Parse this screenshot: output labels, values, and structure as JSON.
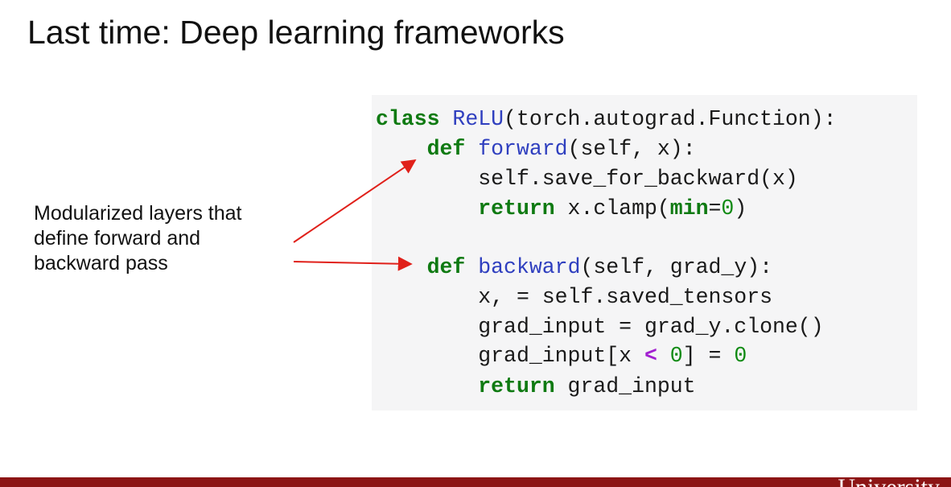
{
  "slide": {
    "title": "Last time: Deep learning frameworks",
    "caption_lines": [
      "Modularized layers that",
      "define forward and",
      "backward pass"
    ]
  },
  "code": {
    "line1": {
      "kw": "class",
      "sp": " ",
      "name": "ReLU",
      "rest": "(torch.autograd.Function):"
    },
    "line2": {
      "indent": "    ",
      "kw": "def",
      "sp": " ",
      "name": "forward",
      "rest": "(self, x):"
    },
    "line3": {
      "indent": "        ",
      "text": "self.save_for_backward(x)"
    },
    "line4": {
      "indent": "        ",
      "kw": "return",
      "a": " x.clamp(",
      "arg": "min",
      "eq": "=",
      "num": "0",
      "close": ")"
    },
    "line5": {
      "indent": "    ",
      "kw": "def",
      "sp": " ",
      "name": "backward",
      "rest": "(self, grad_y):"
    },
    "line6": {
      "indent": "        ",
      "text": "x, = self.saved_tensors"
    },
    "line7": {
      "indent": "        ",
      "text": "grad_input = grad_y.clone()"
    },
    "line8": {
      "indent": "        ",
      "a": "grad_input[x ",
      "op": "<",
      "b": " ",
      "num1": "0",
      "c": "] = ",
      "num2": "0"
    },
    "line9": {
      "indent": "        ",
      "kw": "return",
      "text": " grad_input"
    }
  },
  "footer": {
    "wordmark": "University",
    "color": "#8c1515"
  },
  "colors": {
    "keyword": "#0f7a12",
    "function_name": "#2f3fbf",
    "operator": "#a21fd1",
    "arrow": "#e0201a",
    "code_background": "#f5f5f6"
  }
}
